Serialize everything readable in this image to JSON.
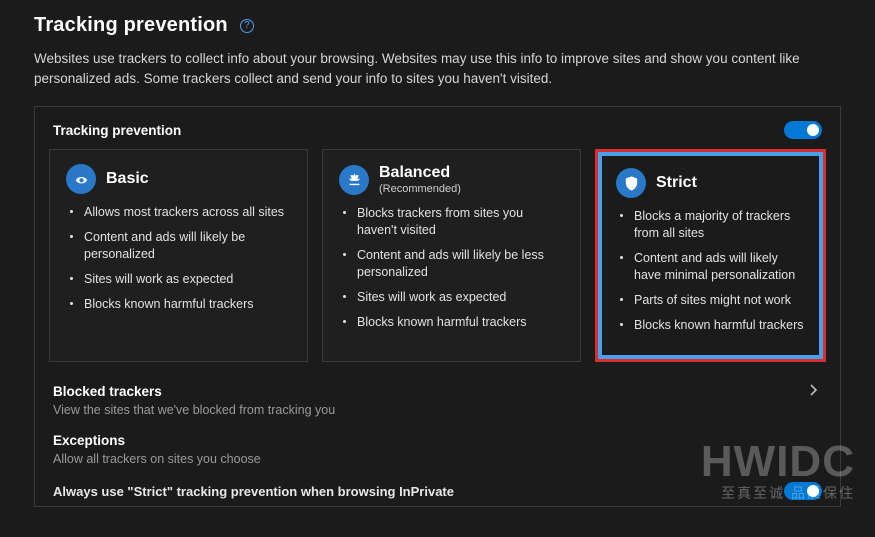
{
  "header": {
    "title": "Tracking prevention",
    "description": "Websites use trackers to collect info about your browsing. Websites may use this info to improve sites and show you content like personalized ads. Some trackers collect and send your info to sites you haven't visited."
  },
  "panel": {
    "title": "Tracking prevention",
    "toggle_on": true
  },
  "cards": {
    "basic": {
      "title": "Basic",
      "bullets": [
        "Allows most trackers across all sites",
        "Content and ads will likely be personalized",
        "Sites will work as expected",
        "Blocks known harmful trackers"
      ]
    },
    "balanced": {
      "title": "Balanced",
      "subtitle": "(Recommended)",
      "bullets": [
        "Blocks trackers from sites you haven't visited",
        "Content and ads will likely be less personalized",
        "Sites will work as expected",
        "Blocks known harmful trackers"
      ]
    },
    "strict": {
      "title": "Strict",
      "selected": true,
      "bullets": [
        "Blocks a majority of trackers from all sites",
        "Content and ads will likely have minimal personalization",
        "Parts of sites might not work",
        "Blocks known harmful trackers"
      ]
    }
  },
  "links": {
    "blocked": {
      "title": "Blocked trackers",
      "desc": "View the sites that we've blocked from tracking you"
    },
    "exceptions": {
      "title": "Exceptions",
      "desc": "Allow all trackers on sites you choose"
    }
  },
  "inprivate": {
    "label": "Always use \"Strict\" tracking prevention when browsing InPrivate"
  },
  "watermark": {
    "big": "HWIDC",
    "small": "至真至诚 品质保住"
  }
}
